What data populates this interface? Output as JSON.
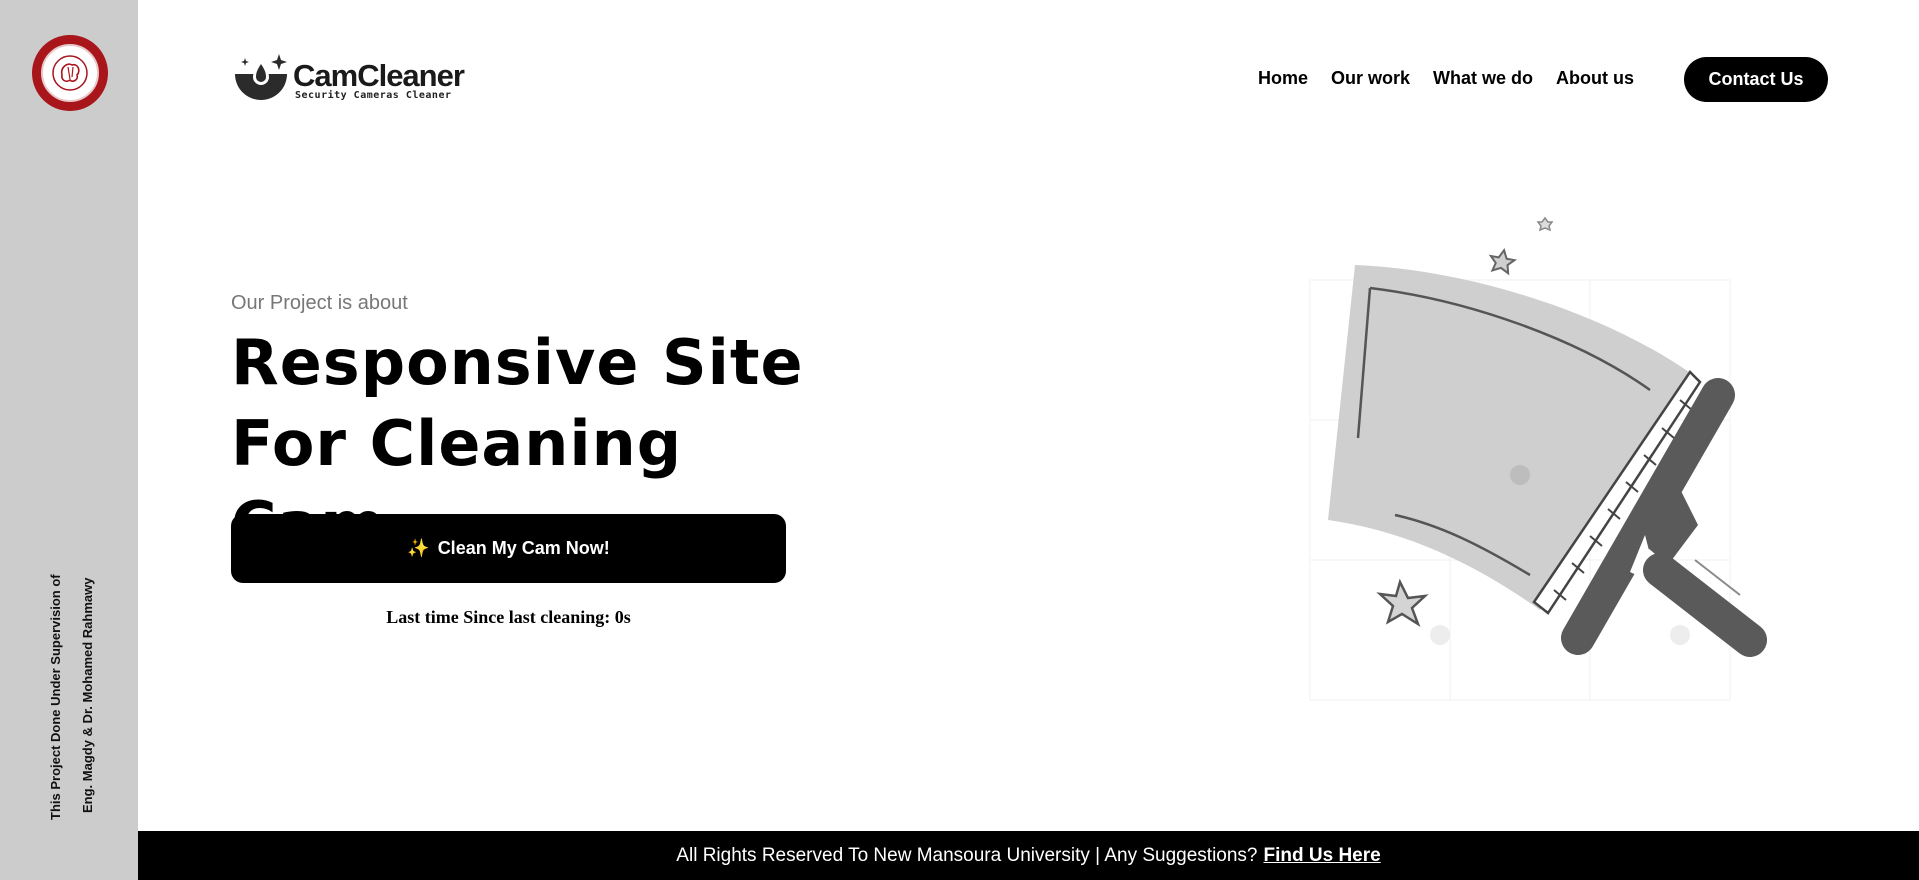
{
  "sidebar": {
    "logo": "university-seal",
    "credit_line_1": "This Project Done Under Supervision of",
    "credit_line_2": "Eng. Magdy & Dr. Mohamed Rahmawy"
  },
  "header": {
    "brand_name": "CamCleaner",
    "brand_tagline": "Security Cameras Cleaner",
    "nav": [
      "Home",
      "Our work",
      "What we do",
      "About us"
    ],
    "contact_label": "Contact Us"
  },
  "hero": {
    "eyebrow": "Our Project is about",
    "title_line_1": "Responsive Site",
    "title_line_2": "For Cleaning Cam",
    "cta_icon": "sparkles-icon",
    "cta_label": "Clean My Cam Now!",
    "last_cleaning": "Last time Since last cleaning: 0s"
  },
  "illustration": {
    "icon": "squeegee-icon"
  },
  "footer": {
    "text": "All Rights Reserved To New Mansoura University | Any Suggestions?",
    "link_label": "Find Us Here"
  },
  "colors": {
    "accent": "#000000",
    "sidebar_bg": "#cccccc",
    "seal_red": "#a8151b",
    "muted_text": "#777777"
  }
}
